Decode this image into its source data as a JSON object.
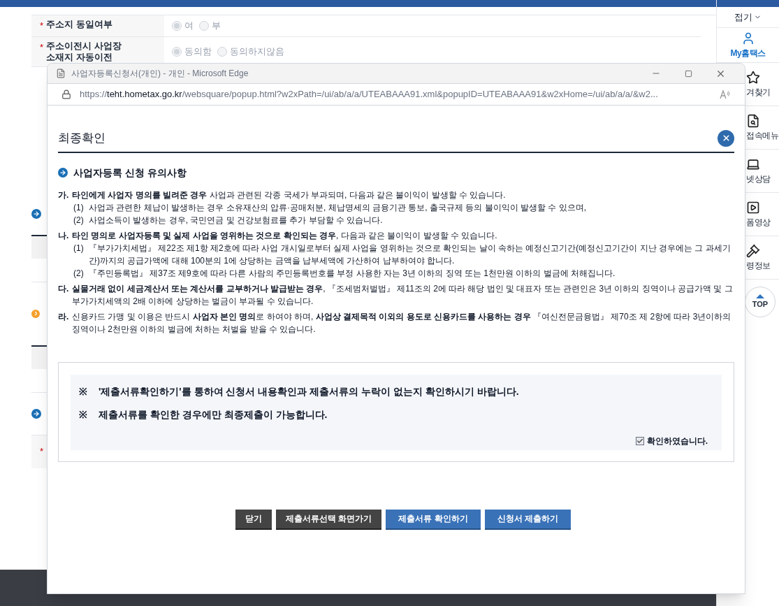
{
  "background": {
    "form_rows": [
      {
        "label": "주소지 동일여부",
        "required": "*",
        "options": [
          {
            "label": "여",
            "selected": true
          },
          {
            "label": "부",
            "selected": false
          }
        ]
      },
      {
        "label": "주소이전시 사업장 소재지 자동이전",
        "required": "*",
        "options": [
          {
            "label": "동의함",
            "selected": true
          },
          {
            "label": "동의하지않음",
            "selected": false
          }
        ]
      }
    ],
    "left_strip": [
      {
        "kind": "arrow"
      },
      {
        "kind": "header"
      },
      {
        "kind": "orange"
      },
      {
        "kind": "header"
      },
      {
        "kind": "arrow"
      },
      {
        "kind": "star",
        "text": "*"
      }
    ],
    "sidebar": {
      "collapse": "접기",
      "items": [
        {
          "label": "My홈택스",
          "selected": true
        },
        {
          "label": "겨찾기",
          "selected": false
        },
        {
          "label": "접속메뉴",
          "selected": false
        },
        {
          "label": "넷상담",
          "selected": false
        },
        {
          "label": "폼영상",
          "selected": false
        },
        {
          "label": "령정보",
          "selected": false
        }
      ],
      "top": "TOP"
    }
  },
  "window": {
    "title": "사업자등록신청서(개인) - 개인 - Microsoft Edge",
    "url_scheme": "https://",
    "url_domain": "teht.hometax.go.kr",
    "url_path": "/websquare/popup.html?w2xPath=/ui/ab/a/a/UTEABAAA91.xml&popupID=UTEABAAA91&w2xHome=/ui/ab/a/a/&w2..."
  },
  "dialog": {
    "title": "최종확인",
    "section": "사업자등록 신청 유의사항",
    "items": [
      {
        "marker": "가.",
        "text": "**타인에게 사업자 명의를 빌려준 경우** 사업과 관련된 각종 국세가 부과되며, 다음과 같은 불이익이 발생할 수 있습니다.",
        "subs": [
          {
            "marker": "(1)",
            "text": "사업과 관련한 체납이 발생하는 경우 소유재산의 압류·공매처분, 체납명세의 금융기관 통보, 출국규제 등의 불이익이 발생할 수 있으며,"
          },
          {
            "marker": "(2)",
            "text": "사업소득이 발생하는 경우, 국민연금 및 건강보험료를 추가 부담할 수 있습니다."
          }
        ]
      },
      {
        "marker": "나.",
        "text": "**타인 명의로 사업자등록 및 실제 사업을 영위하는 것으로 확인되는 경우**, 다음과 같은 불이익이 발생할 수 있습니다.",
        "subs": [
          {
            "marker": "(1)",
            "text": "『부가가치세법』 제22조 제1항 제2호에 따라 사업 개시일로부터 실제 사업을 영위하는 것으로 확인되는 날이 속하는 예정신고기간(예정신고기간이 지난 경우에는 그 과세기간)까지의 공급가액에 대해 100분의 1에 상당하는 금액을 납부세액에 가산하여 납부하여야 합니다."
          },
          {
            "marker": "(2)",
            "text": "『주민등록법』 제37조 제9호에 따라 다른 사람의 주민등록번호를 부정 사용한 자는 3년 이하의 징역 또는 1천만원 이하의 벌금에 처해집니다."
          }
        ]
      },
      {
        "marker": "다.",
        "text": "**실물거래 없이 세금계산서 또는 계산서를 교부하거나 발급받는 경우**, 『조세범처벌법』 제11조의 2에 따라 해당 법인 및 대표자 또는 관련인은 3년 이하의 징역이나 공급가액 및 그 부가가치세액의 2배 이하에 상당하는 벌금이 부과될 수 있습니다."
      },
      {
        "marker": "라.",
        "text": "신용카드 가맹 및 이용은 반드시 **사업자 본인 명의**로 하여야 하며, **사업상 결제목적 이외의 용도로 신용카드를 사용하는 경우** 『여신전문금융법』 제70조 제 2항에 따라 3년이하의 징역이나 2천만원 이하의 벌금에 처하는 처벌을 받을 수 있습니다."
      }
    ],
    "notices": [
      {
        "mark": "※",
        "text": "'제출서류확인하기'를 통하여 신청서 내용확인과 제출서류의 누락이 없는지 확인하시기 바랍니다."
      },
      {
        "mark": "※",
        "text": "제출서류를 확인한 경우에만 최종제출이 가능합니다."
      }
    ],
    "confirm": {
      "label": "확인하였습니다.",
      "checked": true
    },
    "buttons": [
      {
        "label": "닫기",
        "kind": "dark"
      },
      {
        "label": "제출서류선택 화면가기",
        "kind": "dark"
      },
      {
        "label": "제출서류 확인하기",
        "kind": "blue"
      },
      {
        "label": "신청서 제출하기",
        "kind": "blue"
      }
    ]
  }
}
